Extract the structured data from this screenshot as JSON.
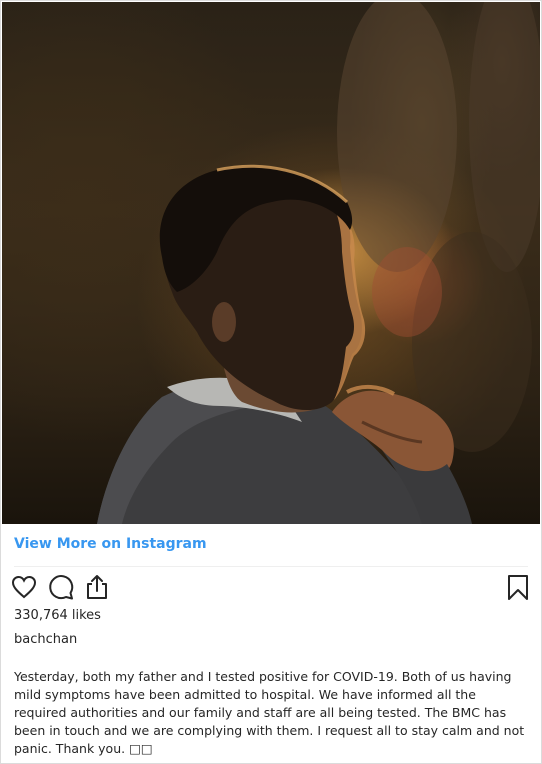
{
  "post": {
    "image_alt": "Man in grey sweater with hand near his chin, backlit by warm light",
    "view_more_label": "View More on Instagram",
    "likes": "330,764 likes",
    "username": "bachchan",
    "caption": "Yesterday, both my father and I tested positive for COVID-19. Both of us having mild symptoms have been admitted to hospital. We have informed all the required authorities and our family and staff are all being tested. The BMC has been in touch and we are complying with them. I request all to stay calm and not panic. Thank you. □□"
  },
  "icons": {
    "like": "heart-icon",
    "comment": "comment-icon",
    "share": "share-icon",
    "save": "bookmark-icon"
  },
  "colors": {
    "link": "#3897f0",
    "text": "#262626",
    "border": "#dbdbdb"
  }
}
